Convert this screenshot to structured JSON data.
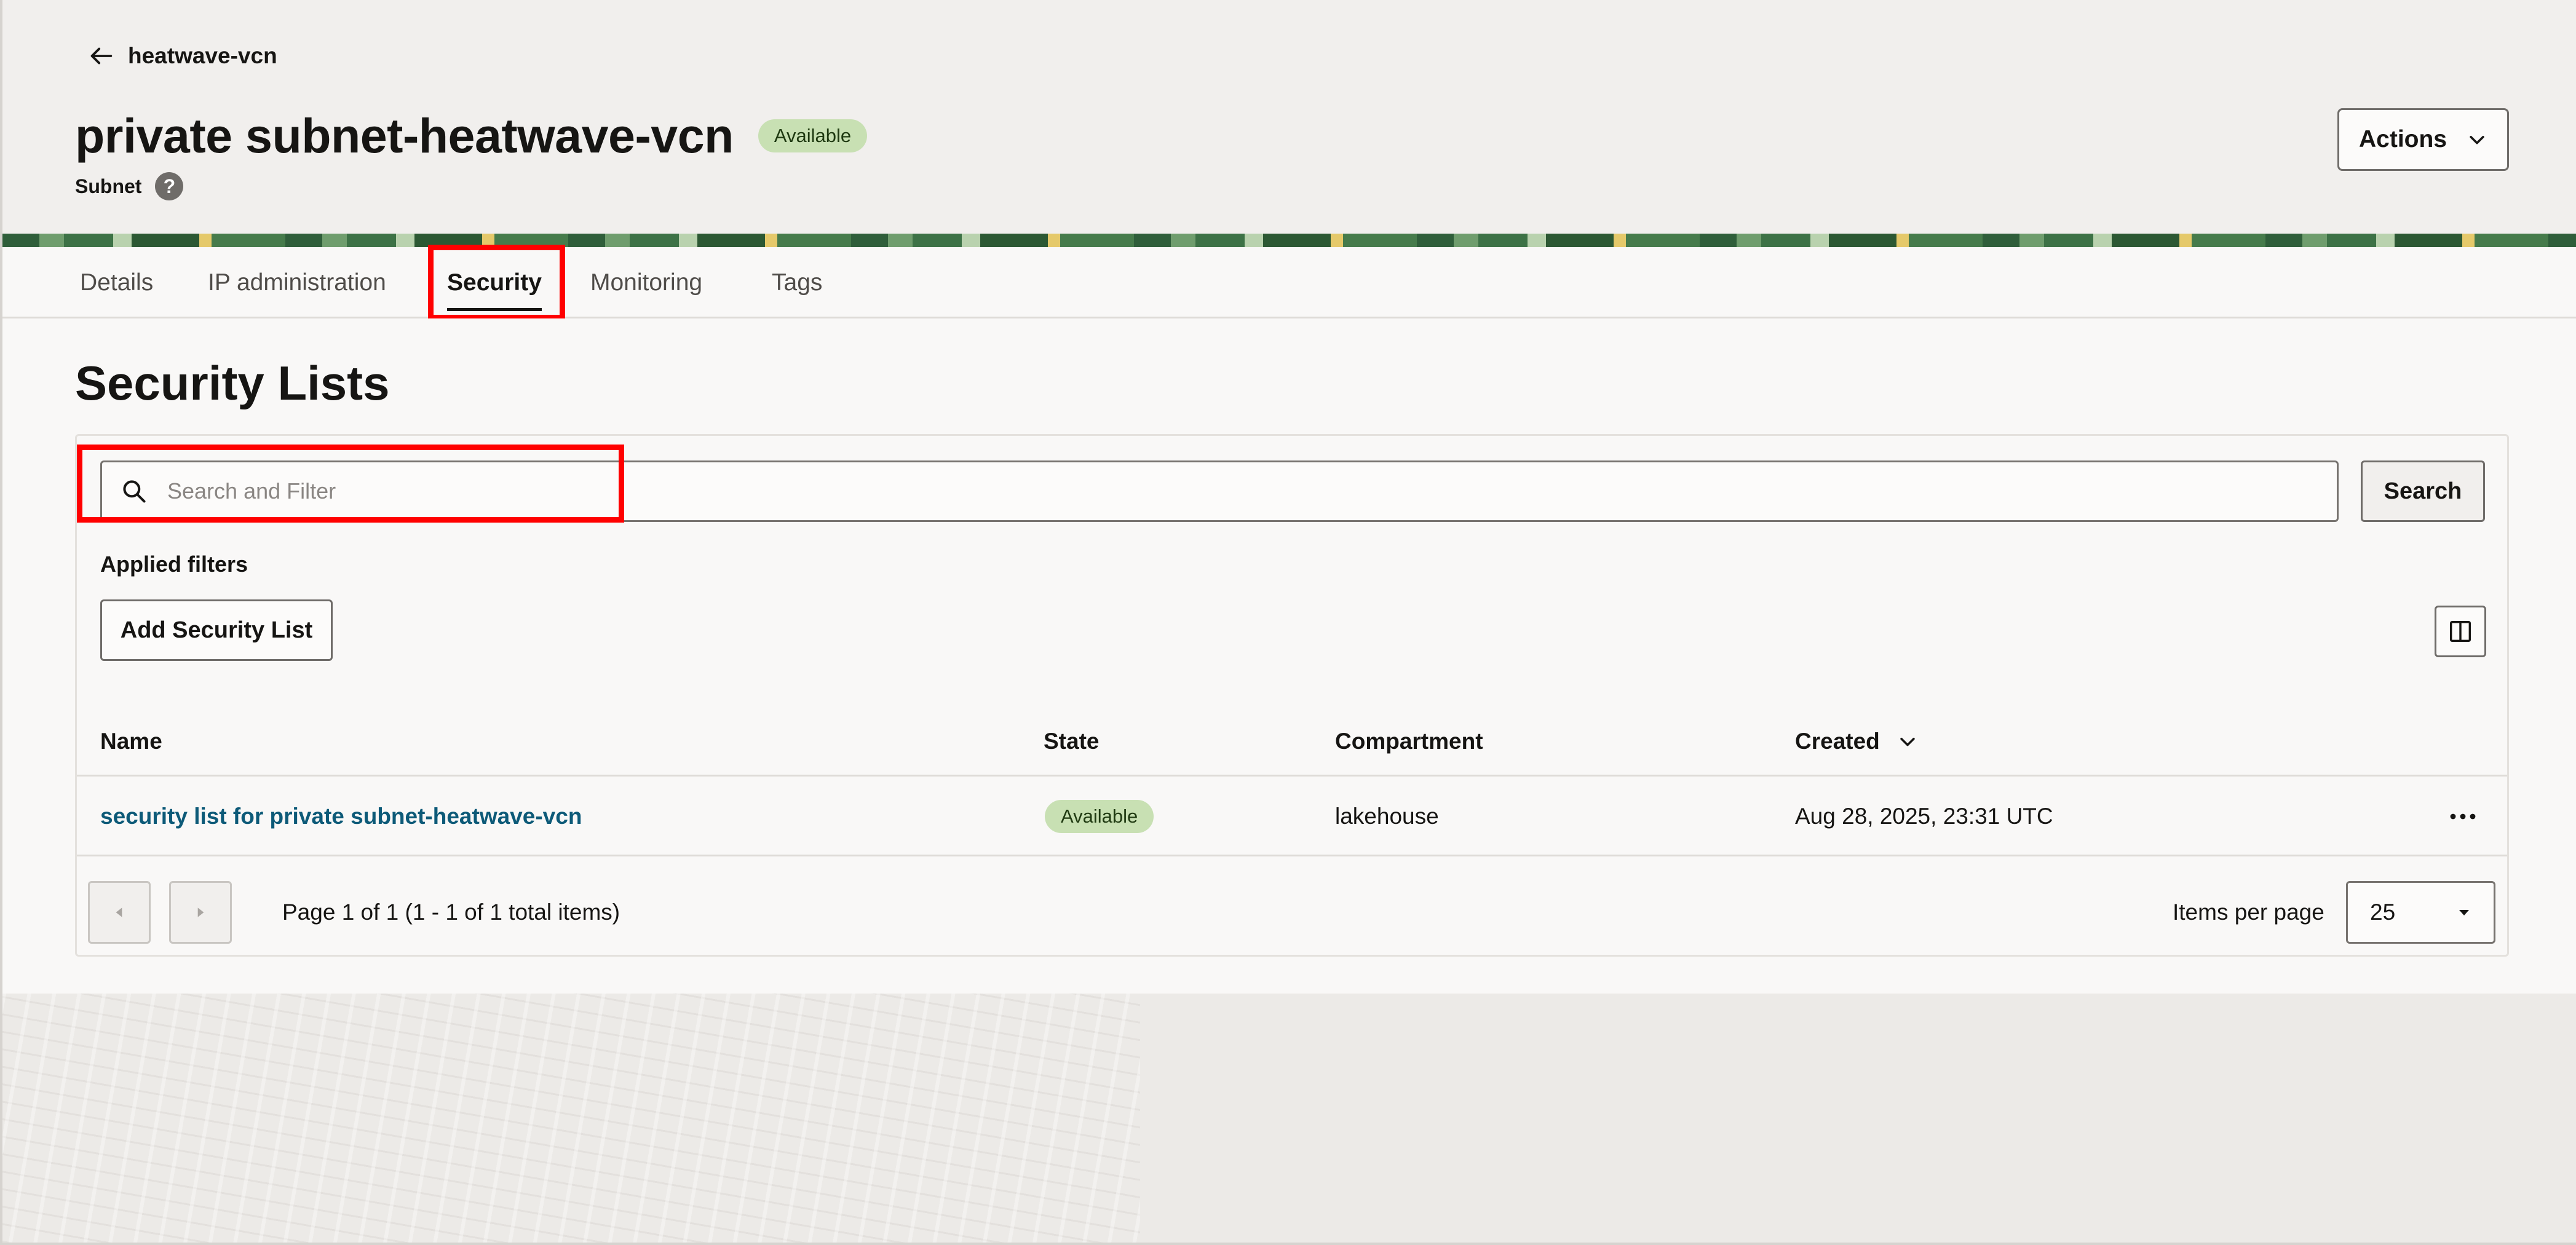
{
  "breadcrumb": {
    "back_label": "heatwave-vcn"
  },
  "header": {
    "title": "private subnet-heatwave-vcn",
    "status_badge": "Available",
    "resource_type": "Subnet",
    "actions_label": "Actions"
  },
  "tabs": [
    {
      "label": "Details",
      "active": false
    },
    {
      "label": "IP administration",
      "active": false
    },
    {
      "label": "Security",
      "active": true
    },
    {
      "label": "Monitoring",
      "active": false
    },
    {
      "label": "Tags",
      "active": false
    }
  ],
  "section": {
    "title": "Security Lists"
  },
  "search": {
    "placeholder": "Search and Filter",
    "button_label": "Search"
  },
  "filters": {
    "applied_label": "Applied filters"
  },
  "toolbar": {
    "add_label": "Add Security List"
  },
  "table": {
    "columns": [
      "Name",
      "State",
      "Compartment",
      "Created"
    ],
    "sort_column": "Created",
    "rows": [
      {
        "name": "security list for private subnet-heatwave-vcn",
        "state": "Available",
        "compartment": "lakehouse",
        "created": "Aug 28, 2025, 23:31 UTC"
      }
    ]
  },
  "pagination": {
    "page_info": "Page 1 of 1 (1 - 1 of 1 total items)",
    "items_per_page_label": "Items per page",
    "items_per_page_value": "25"
  },
  "colors": {
    "accent_link": "#0d5a78",
    "badge_bg": "#c8e0b3",
    "highlight": "#ff0000"
  }
}
